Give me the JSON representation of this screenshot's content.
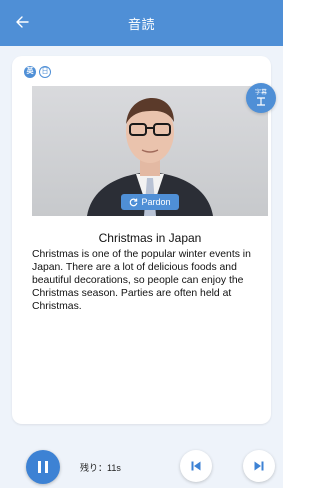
{
  "header": {
    "title": "音読",
    "back_icon": "arrow-left-icon"
  },
  "colors": {
    "accent": "#4f8fd6",
    "background": "#eef3fa"
  },
  "lang_badges": [
    "英",
    "日"
  ],
  "subtitle_button": {
    "label": "字幕",
    "icon": "subtitle-icon"
  },
  "pardon_button": {
    "label": "Pardon",
    "icon": "replay-icon"
  },
  "story": {
    "title": "Christmas in Japan",
    "body": "Christmas is one of the popular winter events in Japan. There are a lot of delicious foods and beautiful decorations, so people can enjoy the Christmas season. Parties are often held at Christmas."
  },
  "controls": {
    "remaining": "残り：11s",
    "play_icon": "pause-icon",
    "prev_icon": "skip-previous-icon",
    "next_icon": "skip-next-icon"
  }
}
